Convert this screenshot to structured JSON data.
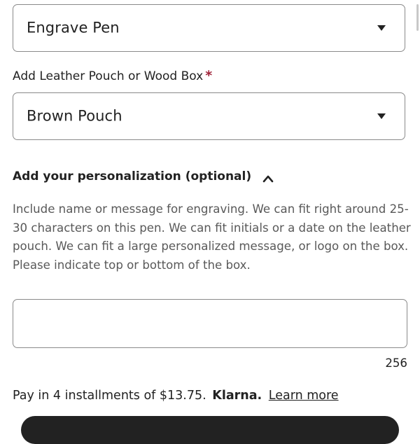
{
  "selects": {
    "engrave": {
      "value": "Engrave Pen"
    },
    "pouch": {
      "label": "Add Leather Pouch or Wood Box",
      "required_mark": "*",
      "value": "Brown Pouch"
    }
  },
  "personalization": {
    "title": "Add your personalization (optional)",
    "description": "Include name or message for engraving. We can fit right around 25-30 characters on this pen. We can fit initials or a date on the leather pouch. We can fit a large personalized message, or logo on the box. Please indicate top or bottom of the box.",
    "input_value": "",
    "char_count": "256"
  },
  "payment": {
    "text": "Pay in 4 installments of $13.75.",
    "brand": "Klarna.",
    "link": "Learn more"
  },
  "icons": {
    "select_caret": "caret-down-icon",
    "section_toggle": "chevron-up-icon"
  }
}
